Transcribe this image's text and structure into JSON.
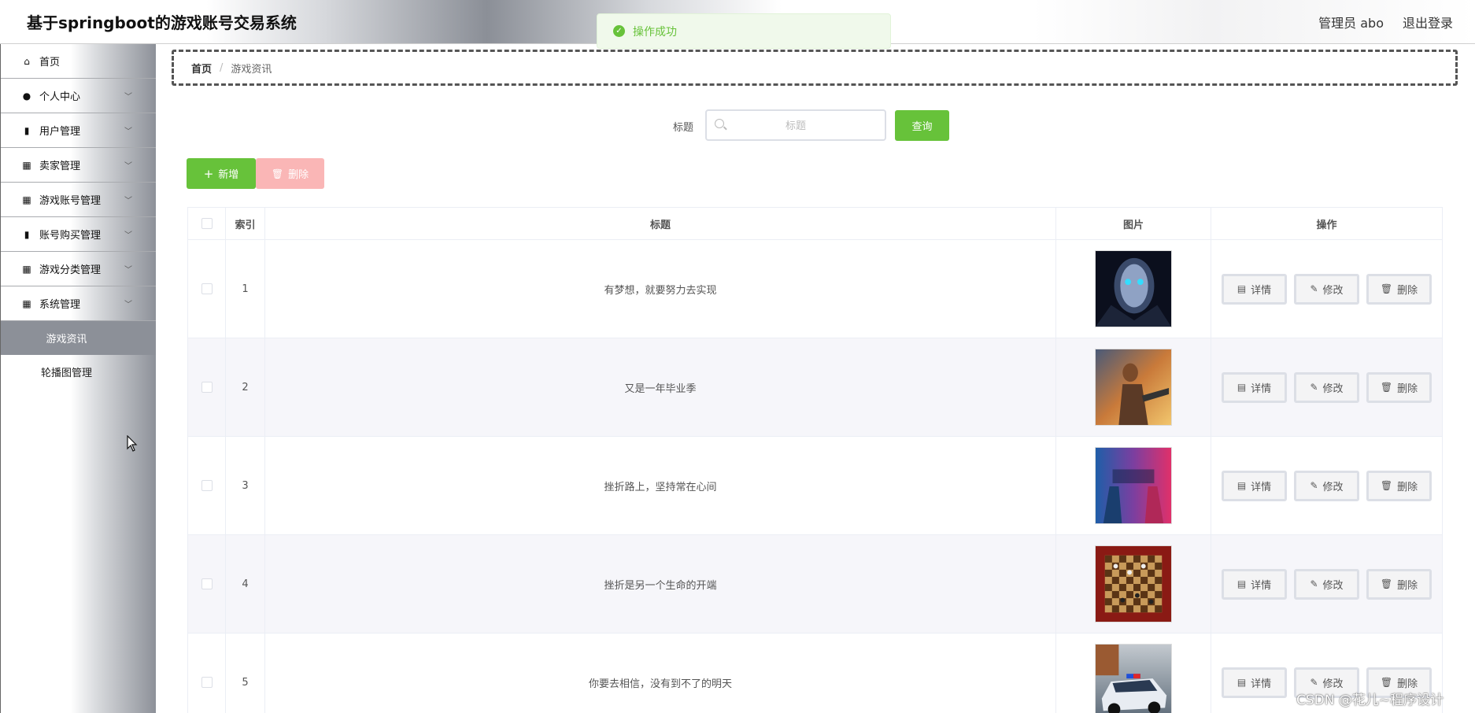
{
  "header": {
    "app_title": "基于springboot的游戏账号交易系统",
    "user_label": "管理员 abo",
    "logout_label": "退出登录"
  },
  "toast": {
    "message": "操作成功"
  },
  "sidebar": {
    "items": [
      {
        "label": "首页",
        "icon": "home-icon",
        "expandable": false
      },
      {
        "label": "个人中心",
        "icon": "user-icon",
        "expandable": true
      },
      {
        "label": "用户管理",
        "icon": "clipboard-icon",
        "expandable": true
      },
      {
        "label": "卖家管理",
        "icon": "grid-icon",
        "expandable": true
      },
      {
        "label": "游戏账号管理",
        "icon": "grid-icon",
        "expandable": true
      },
      {
        "label": "账号购买管理",
        "icon": "clipboard-check-icon",
        "expandable": true
      },
      {
        "label": "游戏分类管理",
        "icon": "grid-9-icon",
        "expandable": true
      },
      {
        "label": "系统管理",
        "icon": "grid-icon",
        "expandable": true
      }
    ],
    "sub_items": [
      {
        "label": "游戏资讯",
        "active": true
      },
      {
        "label": "轮播图管理",
        "active": false
      }
    ]
  },
  "breadcrumb": {
    "home": "首页",
    "separator": "/",
    "current": "游戏资讯"
  },
  "search": {
    "label": "标题",
    "placeholder": "标题",
    "value": "",
    "button": "查询"
  },
  "actions": {
    "add": "新增",
    "delete": "删除"
  },
  "table": {
    "columns": {
      "index": "索引",
      "title": "标题",
      "image": "图片",
      "ops": "操作"
    },
    "op_labels": {
      "detail": "详情",
      "edit": "修改",
      "delete": "删除"
    },
    "rows": [
      {
        "index": "1",
        "title": "有梦想，就要努力去实现",
        "image_desc": "dark-warrior-portrait"
      },
      {
        "index": "2",
        "title": "又是一年毕业季",
        "image_desc": "game-hero-art"
      },
      {
        "index": "3",
        "title": "挫折路上，坚持常在心间",
        "image_desc": "match-day-poster"
      },
      {
        "index": "4",
        "title": "挫折是另一个生命的开端",
        "image_desc": "chess-board"
      },
      {
        "index": "5",
        "title": "你要去相信，没有到不了的明天",
        "image_desc": "police-car"
      }
    ]
  },
  "watermark": "CSDN @花儿~程序设计",
  "colors": {
    "primary": "#67c23a",
    "danger_disabled": "#fab6b6",
    "toast_bg": "#f0f9eb",
    "sidebar_active": "#8c9098"
  }
}
